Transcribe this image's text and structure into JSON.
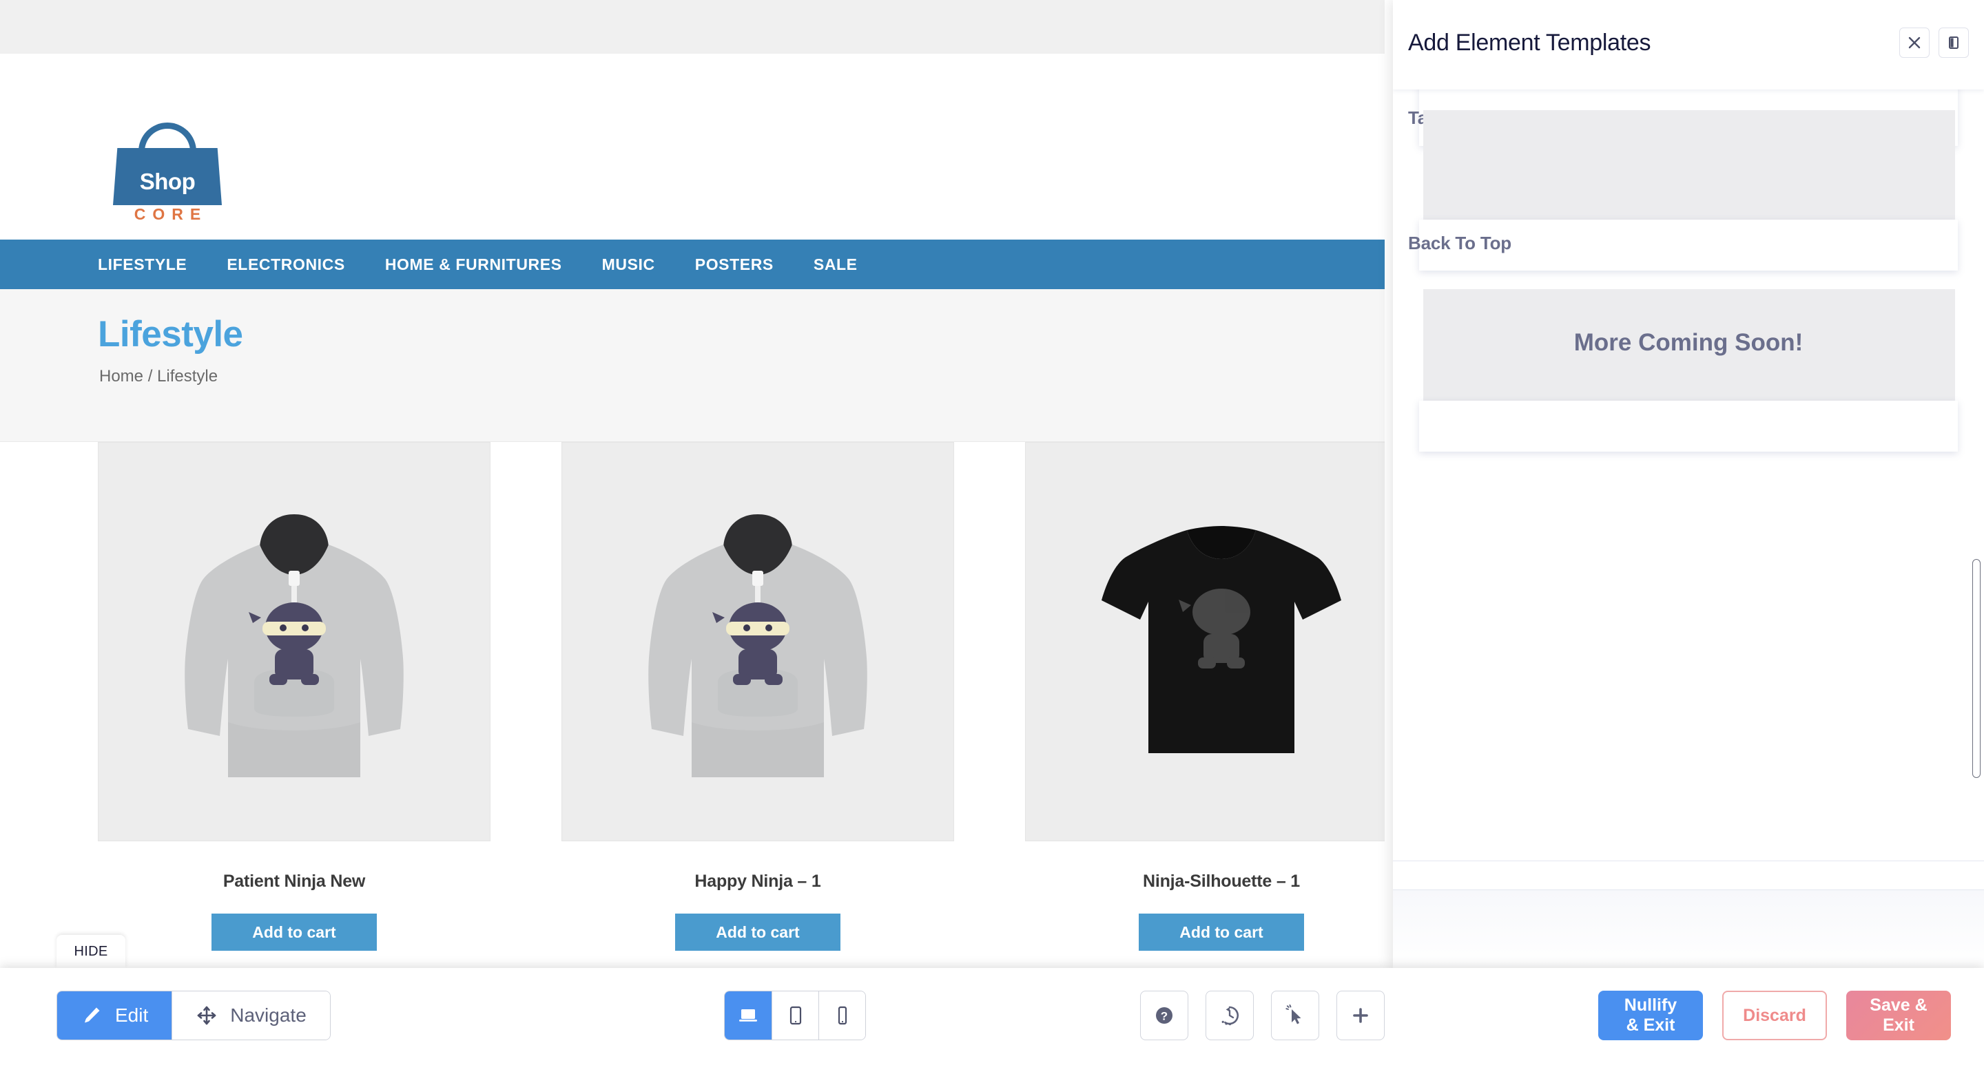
{
  "preview": {
    "logo": {
      "bag_text": "Shop",
      "sub_text": "CORE"
    },
    "nav": [
      {
        "label": "LIFESTYLE"
      },
      {
        "label": "ELECTRONICS"
      },
      {
        "label": "HOME & FURNITURES"
      },
      {
        "label": "MUSIC"
      },
      {
        "label": "POSTERS"
      },
      {
        "label": "SALE"
      }
    ],
    "page_title": "Lifestyle",
    "breadcrumb": "Home / Lifestyle",
    "products": [
      {
        "name": "Patient Ninja New",
        "cart_label": "Add to cart",
        "image": "grey-hoodie-ninja"
      },
      {
        "name": "Happy Ninja – 1",
        "cart_label": "Add to cart",
        "image": "grey-hoodie-ninja"
      },
      {
        "name": "Ninja-Silhouette – 1",
        "cart_label": "Add to cart",
        "image": "black-tshirt-ninja"
      }
    ]
  },
  "hide_tab": {
    "label": "HIDE"
  },
  "panel": {
    "title": "Add Element Templates",
    "close_icon": "close-icon",
    "dock_icon": "panel-dock-icon",
    "templates": [
      {
        "label": "Tab Talk",
        "thumb_text": ""
      },
      {
        "label": "Back To Top",
        "thumb_text": ""
      },
      {
        "label": "",
        "thumb_text": "More Coming Soon!"
      }
    ]
  },
  "toolbar": {
    "modes": [
      {
        "label": "Edit",
        "icon": "pencil-icon",
        "active": true
      },
      {
        "label": "Navigate",
        "icon": "move-arrows-icon",
        "active": false
      }
    ],
    "devices": [
      {
        "icon": "laptop-icon",
        "active": true
      },
      {
        "icon": "tablet-icon",
        "active": false
      },
      {
        "icon": "mobile-icon",
        "active": false
      }
    ],
    "icon_buttons": [
      {
        "icon": "help-question-icon"
      },
      {
        "icon": "history-clock-icon"
      },
      {
        "icon": "click-cursor-icon"
      },
      {
        "icon": "plus-icon"
      }
    ],
    "actions": [
      {
        "label": "Nullify\n& Exit",
        "style": "nullify"
      },
      {
        "label": "Discard",
        "style": "discard"
      },
      {
        "label": "Save &\nExit",
        "style": "save"
      }
    ]
  },
  "colors": {
    "brand_blue": "#336ea0",
    "nav_blue": "#3580b5",
    "title_blue": "#4ba3dd",
    "accent_orange": "#df7543",
    "toolbar_blue": "#4a90f0",
    "save_pink": "#e8879c",
    "panel_text": "#6a6e8c"
  }
}
